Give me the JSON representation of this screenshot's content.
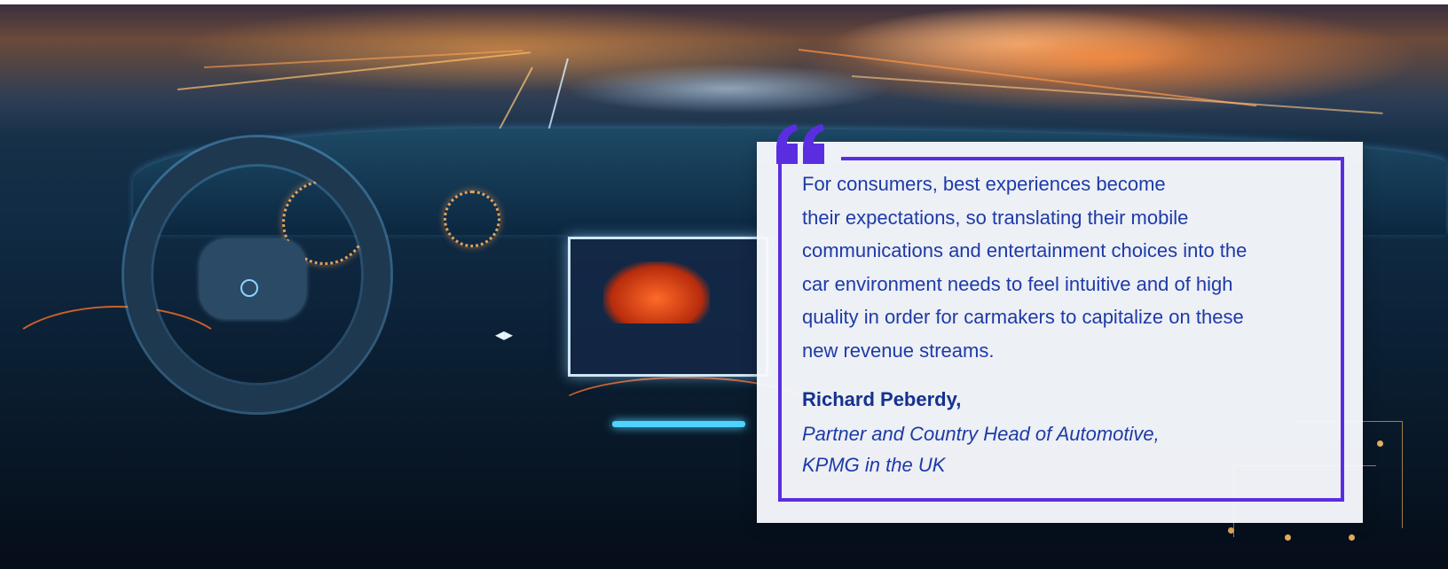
{
  "quote": {
    "lines": [
      "For consumers, best experiences become",
      "their expectations, so translating their mobile",
      "communications and entertainment choices into the",
      "car environment needs to feel intuitive and of high",
      "quality in order for carmakers to capitalize on these",
      "new revenue streams."
    ],
    "accent_color": "#5a2ee0",
    "text_color": "#1e3aa8"
  },
  "author": {
    "name": "Richard Peberdy,",
    "role_lines": [
      "Partner and Country Head of Automotive,",
      "KPMG in the UK"
    ]
  },
  "icons": {
    "quote_mark": "quote-mark-icon",
    "screen_arrows": "◂▸"
  }
}
